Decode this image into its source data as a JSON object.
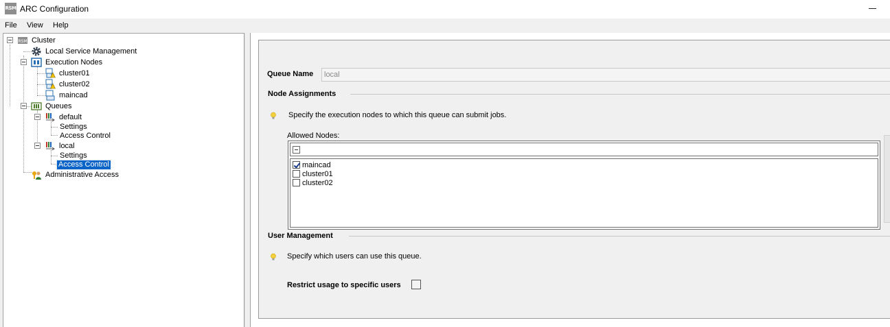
{
  "window": {
    "app_icon_text": "RSM",
    "title": "ARC Configuration"
  },
  "menu": [
    "File",
    "View",
    "Help"
  ],
  "tree": {
    "cluster": "Cluster",
    "local_service_management": "Local Service Management",
    "execution_nodes": "Execution Nodes",
    "nodes": [
      "cluster01",
      "cluster02",
      "maincad"
    ],
    "queues": "Queues",
    "queue_default": "default",
    "queue_local": "local",
    "settings": "Settings",
    "access_control": "Access Control",
    "administrative_access": "Administrative Access"
  },
  "form": {
    "queue_name_label": "Queue Name",
    "queue_name_value": "local",
    "node_assignments_title": "Node Assignments",
    "node_assignments_hint": "Specify the execution nodes to which this queue can submit jobs.",
    "allowed_nodes_label": "Allowed Nodes:",
    "allowed_nodes": [
      {
        "name": "maincad",
        "checked": true
      },
      {
        "name": "cluster01",
        "checked": false
      },
      {
        "name": "cluster02",
        "checked": false
      }
    ],
    "user_management_title": "User Management",
    "user_management_hint": "Specify which users can use this queue.",
    "restrict_label": "Restrict usage to specific users",
    "restrict_checked": false
  },
  "colors": {
    "selection": "#0a64c8",
    "bulb": "#f4d03f"
  }
}
